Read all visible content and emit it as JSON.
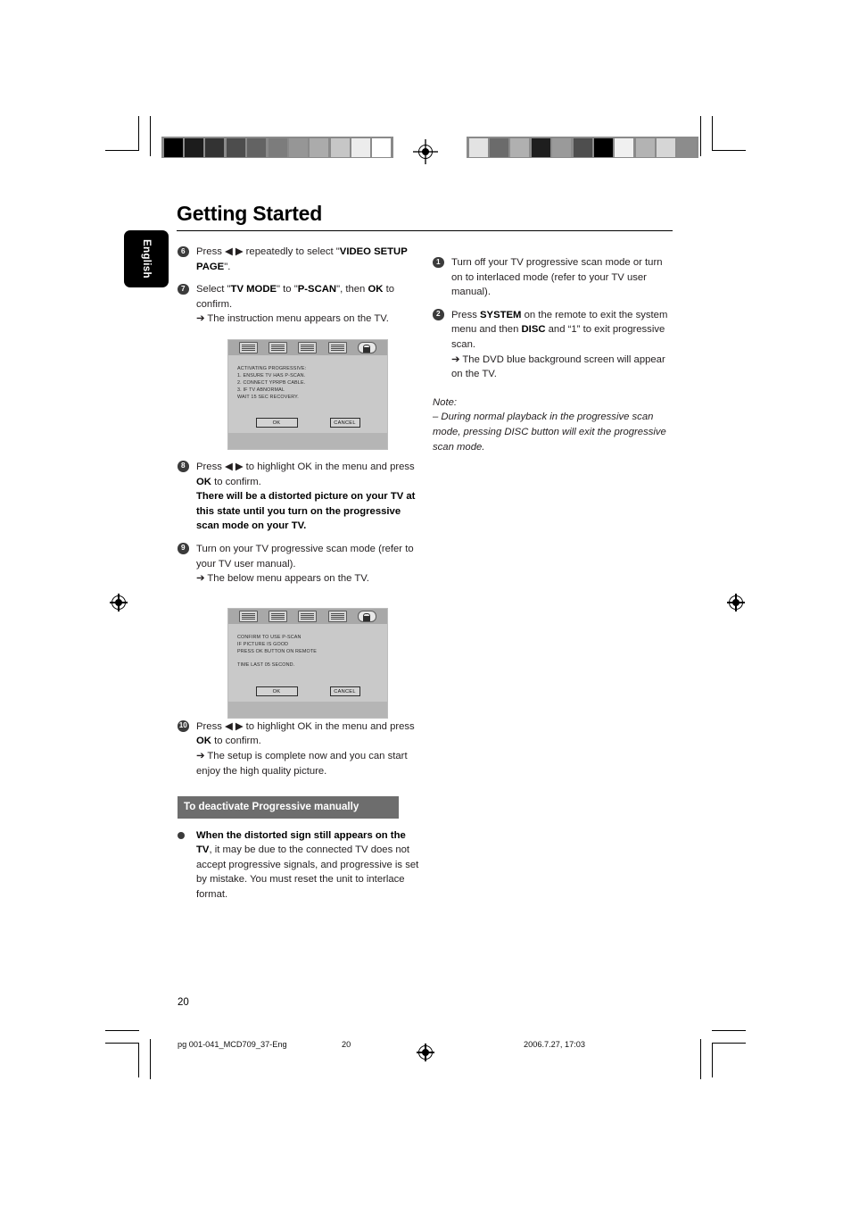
{
  "document": {
    "title": "Getting Started",
    "language_tab": "English",
    "page_number": "20"
  },
  "left_column": {
    "steps": [
      {
        "number": "6",
        "segments": [
          {
            "text": "Press ",
            "style": "normal"
          },
          {
            "text": "◀ ▶",
            "style": "normal"
          },
          {
            "text": " repeatedly to select \"",
            "style": "normal"
          },
          {
            "text": "VIDEO SETUP PAGE",
            "style": "bold"
          },
          {
            "text": "\".",
            "style": "normal"
          }
        ]
      },
      {
        "number": "7",
        "segments": [
          {
            "text": "Select \"",
            "style": "normal"
          },
          {
            "text": "TV MODE",
            "style": "bold"
          },
          {
            "text": "\" to \"",
            "style": "normal"
          },
          {
            "text": "P-SCAN",
            "style": "bold"
          },
          {
            "text": "\", then ",
            "style": "normal"
          },
          {
            "text": "OK",
            "style": "bold"
          },
          {
            "text": " to confirm.",
            "style": "normal"
          }
        ],
        "arrow": "➔ The instruction menu appears on the TV."
      },
      {
        "number": "8",
        "segments": [
          {
            "text": "Press ",
            "style": "normal"
          },
          {
            "text": "◀ ▶",
            "style": "normal"
          },
          {
            "text": " to highlight OK in the menu and press ",
            "style": "normal"
          },
          {
            "text": "OK",
            "style": "bold"
          },
          {
            "text": " to confirm.",
            "style": "normal"
          }
        ],
        "bold_block": "There will be a distorted picture on your TV at this state until you turn on the progressive scan mode on your TV."
      },
      {
        "number": "9",
        "segments": [
          {
            "text": "Turn on your TV progressive scan mode (refer to your TV user manual).",
            "style": "normal"
          }
        ],
        "arrow": "➔ The below menu appears on the TV."
      },
      {
        "number": "10",
        "segments": [
          {
            "text": "Press ",
            "style": "normal"
          },
          {
            "text": "◀ ▶",
            "style": "normal"
          },
          {
            "text": " to highlight OK in the menu and press ",
            "style": "normal"
          },
          {
            "text": "OK",
            "style": "bold"
          },
          {
            "text": " to confirm.",
            "style": "normal"
          }
        ],
        "arrow": "➔ The setup is complete now and you can start enjoy the high quality picture."
      }
    ],
    "section_heading": "To deactivate Progressive manually",
    "bullet": {
      "bold_lead": "When the distorted sign still appears on the TV",
      "rest": ", it may be due to the connected TV does not accept progressive signals, and progressive is set by mistake. You must reset the unit to interlace format."
    }
  },
  "right_column": {
    "steps": [
      {
        "number": "1",
        "segments": [
          {
            "text": "Turn off your TV progressive scan mode or turn on to interlaced mode (refer to your TV user manual).",
            "style": "normal"
          }
        ]
      },
      {
        "number": "2",
        "segments": [
          {
            "text": "Press ",
            "style": "normal"
          },
          {
            "text": "SYSTEM",
            "style": "bold"
          },
          {
            "text": " on the remote to exit the system menu and then ",
            "style": "normal"
          },
          {
            "text": "DISC",
            "style": "bold"
          },
          {
            "text": " and “1” to exit progressive scan.",
            "style": "normal"
          }
        ],
        "arrow": "➔ The DVD blue background screen will appear on the TV."
      }
    ],
    "note": {
      "heading": "Note:",
      "body": "–   During normal playback in the progressive scan mode, pressing DISC button will exit the progressive scan mode."
    }
  },
  "osd_menus": [
    {
      "name": "activating-progressive-menu",
      "icons": [
        "tv-icon",
        "audio-icon",
        "video-icon",
        "preference-icon",
        "lock-icon"
      ],
      "lines": [
        "ACTIVATING PROGRESSIVE:",
        "1. ENSURE TV HAS P-SCAN.",
        "2. CONNECT YPRPB CABLE.",
        "3. IF TV ABNORMAL",
        "WAIT 15 SEC RECOVERY."
      ],
      "buttons": {
        "ok": "OK",
        "cancel": "CANCEL"
      }
    },
    {
      "name": "confirm-pscan-menu",
      "icons": [
        "tv-icon",
        "audio-icon",
        "video-icon",
        "preference-icon",
        "lock-icon"
      ],
      "lines": [
        "CONFIRM TO USE P-SCAN",
        "IF PICTURE IS GOOD",
        "PRESS OK BUTTON ON REMOTE",
        "",
        "TIME LAST 05 SECOND."
      ],
      "buttons": {
        "ok": "OK",
        "cancel": "CANCEL"
      }
    }
  ],
  "footer": {
    "file_label": "pg 001-041_MCD709_37-Eng",
    "page_ref": "20",
    "timestamp": "2006.7.27, 17:03"
  },
  "print_marks": {
    "graybar_left": [
      "#000000",
      "#1c1c1c",
      "#333333",
      "#4d4d4d",
      "#636363",
      "#7c7c7c",
      "#969696",
      "#ababab",
      "#c6c6c6",
      "#ececec",
      "#ffffff"
    ],
    "graybar_right": [
      "#e3e3e3",
      "#6b6b6b",
      "#b0b0b0",
      "#1e1e1e",
      "#9a9a9a",
      "#4e4e4e",
      "#000000",
      "#f0f0f0",
      "#b3b3b3",
      "#d6d6d6",
      "#8c8c8c"
    ]
  }
}
